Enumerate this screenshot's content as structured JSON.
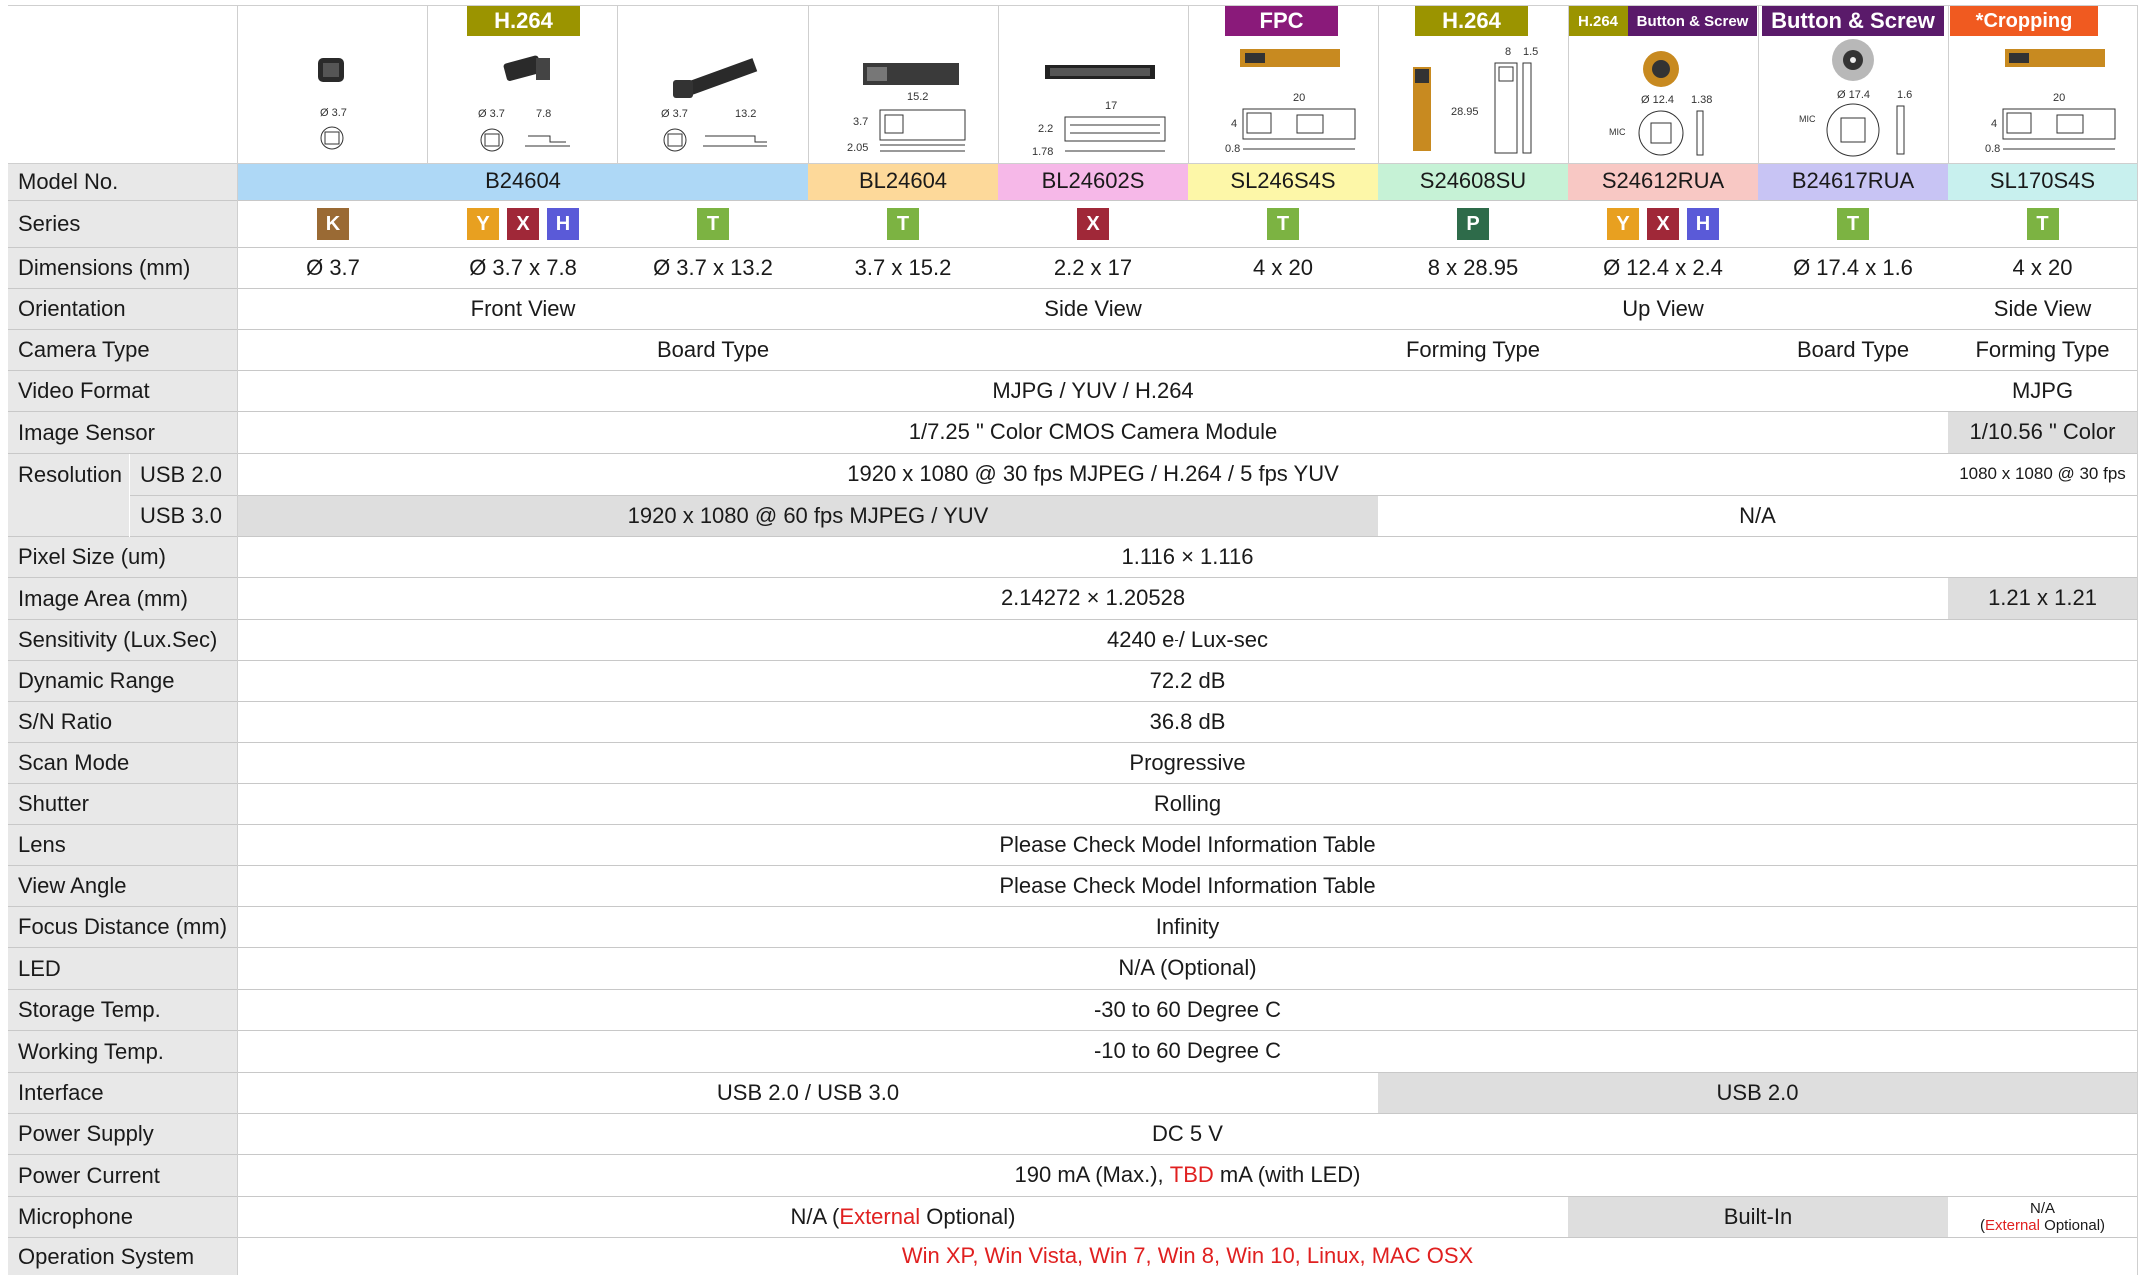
{
  "header_tags": {
    "b1": "H.264",
    "fpc": "FPC",
    "h264_2": "H.264",
    "h264_3": "H.264",
    "button_screw_small": "Button & Screw",
    "button_screw": "Button & Screw",
    "cropping": "*Cropping"
  },
  "dims": {
    "d1": "Ø 3.7",
    "d2a": "Ø 3.7",
    "d2b": "7.8",
    "d3a": "Ø 3.7",
    "d3b": "13.2",
    "d4a": "15.2",
    "d4b": "3.7",
    "d4c": "2.05",
    "d5a": "17",
    "d5b": "2.2",
    "d5c": "1.78",
    "d6a": "20",
    "d6b": "4",
    "d6c": "0.8",
    "d7a": "8",
    "d7b": "1.5",
    "d7c": "28.95",
    "d8a": "Ø 12.4",
    "d8b": "1.38",
    "d8c": "MIC",
    "d9a": "Ø 17.4",
    "d9b": "1.6",
    "d9c": "MIC",
    "d10a": "20",
    "d10b": "4",
    "d10c": "0.8"
  },
  "rows": {
    "model": {
      "label": "Model No.",
      "v1": "B24604",
      "v2": "BL24604",
      "v3": "BL24602S",
      "v4": "SL246S4S",
      "v5": "S24608SU",
      "v6": "S24612RUA",
      "v7": "B24617RUA",
      "v8": "SL170S4S"
    },
    "series": {
      "label": "Series"
    },
    "dimensions": {
      "label": "Dimensions (mm)",
      "v1": "Ø 3.7",
      "v2": "Ø 3.7 x 7.8",
      "v3": "Ø 3.7 x 13.2",
      "v4": "3.7 x 15.2",
      "v5": "2.2 x 17",
      "v6": "4 x 20",
      "v7": "8 x 28.95",
      "v8": "Ø 12.4 x 2.4",
      "v9": "Ø 17.4 x 1.6",
      "v10": "4 x 20"
    },
    "orientation": {
      "label": "Orientation",
      "v1": "Front View",
      "v2": "Side View",
      "v3": "Up View",
      "v4": "Side View"
    },
    "camera_type": {
      "label": "Camera Type",
      "v1": "Board Type",
      "v2": "Forming Type",
      "v3": "Board Type",
      "v4": "Forming Type"
    },
    "video_format": {
      "label": "Video Format",
      "v1": "MJPG / YUV / H.264",
      "v2": "MJPG"
    },
    "image_sensor": {
      "label": "Image Sensor",
      "v1": "1/7.25 \" Color CMOS Camera Module",
      "v2": "1/10.56 \" Color"
    },
    "resolution": {
      "label": "Resolution",
      "usb2": "USB 2.0",
      "usb3": "USB 3.0",
      "v_usb2": "1920 x 1080 @ 30 fps MJPEG / H.264 / 5 fps YUV",
      "v_usb2_last": "1080 x 1080 @ 30 fps",
      "v_usb3": "1920 x 1080 @ 60 fps MJPEG / YUV",
      "v_usb3_na": "N/A"
    },
    "pixel_size": {
      "label": "Pixel Size (um)",
      "v1": "1.116 × 1.116"
    },
    "image_area": {
      "label": "Image Area (mm)",
      "v1": "2.14272 × 1.20528",
      "v2": "1.21 x 1.21"
    },
    "sensitivity": {
      "label": "Sensitivity (Lux.Sec)",
      "v1_pre": "4240 e",
      "v1_sup": "-",
      "v1_post": " / Lux-sec"
    },
    "dynamic_range": {
      "label": "Dynamic Range",
      "v1": "72.2 dB"
    },
    "sn_ratio": {
      "label": "S/N Ratio",
      "v1": "36.8 dB"
    },
    "scan_mode": {
      "label": "Scan Mode",
      "v1": "Progressive"
    },
    "shutter": {
      "label": "Shutter",
      "v1": "Rolling"
    },
    "lens": {
      "label": "Lens",
      "v1": "Please Check Model Information Table"
    },
    "view_angle": {
      "label": "View Angle",
      "v1": "Please Check Model Information Table"
    },
    "focus_distance": {
      "label": "Focus Distance (mm)",
      "v1": "Infinity"
    },
    "led": {
      "label": "LED",
      "v1": "N/A (Optional)"
    },
    "storage_temp": {
      "label": "Storage Temp.",
      "v1": "-30 to 60 Degree C"
    },
    "working_temp": {
      "label": "Working Temp.",
      "v1": "-10 to 60 Degree C"
    },
    "interface": {
      "label": "Interface",
      "v1": "USB 2.0 / USB 3.0",
      "v2": "USB 2.0"
    },
    "power_supply": {
      "label": "Power Supply",
      "v1": "DC 5 V"
    },
    "power_current": {
      "label": "Power Current",
      "v1_pre": "190 mA (Max.), ",
      "v1_red": "TBD",
      "v1_post": " mA (with LED)"
    },
    "microphone": {
      "label": "Microphone",
      "v1_pre": "N/A (",
      "v1_red": "External",
      "v1_post": " Optional)",
      "v2": "Built-In",
      "v3_top": "N/A",
      "v3_pre": "(",
      "v3_red": "External",
      "v3_post": " Optional)"
    },
    "os": {
      "label": "Operation System",
      "v1": "Win XP, Win Vista, Win 7, Win 8, Win 10, Linux, MAC OSX"
    }
  },
  "series_badges": {
    "c1": [
      {
        "letter": "K",
        "color": "#9a6a34"
      }
    ],
    "c2": [
      {
        "letter": "Y",
        "color": "#e8a020"
      },
      {
        "letter": "X",
        "color": "#a02838"
      },
      {
        "letter": "H",
        "color": "#5a5ad8"
      }
    ],
    "c3": [
      {
        "letter": "T",
        "color": "#7cb342"
      }
    ],
    "c4": [
      {
        "letter": "T",
        "color": "#7cb342"
      }
    ],
    "c5": [
      {
        "letter": "X",
        "color": "#a02838"
      }
    ],
    "c6": [
      {
        "letter": "T",
        "color": "#7cb342"
      }
    ],
    "c7": [
      {
        "letter": "P",
        "color": "#2e6b4a"
      }
    ],
    "c8": [
      {
        "letter": "Y",
        "color": "#e8a020"
      },
      {
        "letter": "X",
        "color": "#a02838"
      },
      {
        "letter": "H",
        "color": "#5a5ad8"
      }
    ],
    "c9": [
      {
        "letter": "T",
        "color": "#7cb342"
      }
    ],
    "c10": [
      {
        "letter": "T",
        "color": "#7cb342"
      }
    ]
  },
  "colors": {
    "model_b24604": "#aed8f6",
    "model_bl24604": "#fdd99a",
    "model_bl24602s": "#f6b8e8",
    "model_sl246s4s": "#fdf7a8",
    "model_s24608su": "#c6f2d6",
    "model_s24612rua": "#f8c8c4",
    "model_b24617rua": "#c8c4f4",
    "model_sl170s4s": "#c8f0ee",
    "tag_olive": "#9b9400",
    "tag_purple": "#8a1a7a",
    "tag_deep_purple": "#5a1a6a",
    "tag_orange": "#f05a20",
    "label_bg": "#e8e8e8",
    "red_text": "#e02020"
  }
}
